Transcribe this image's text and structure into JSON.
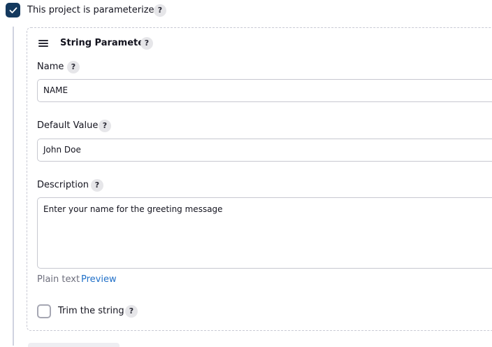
{
  "parameterized": {
    "label": "This project is parameterized",
    "checked": true,
    "help": "?"
  },
  "parameter": {
    "title": "String Parameter",
    "help": "?",
    "name": {
      "label": "Name",
      "help": "?",
      "value": "NAME"
    },
    "default_value": {
      "label": "Default Value",
      "help": "?",
      "value": "John Doe"
    },
    "description": {
      "label": "Description",
      "help": "?",
      "value": "Enter your name for the greeting message",
      "plain_text": "Plain text",
      "preview": "Preview"
    },
    "trim": {
      "label": "Trim the string",
      "help": "?",
      "checked": false
    }
  },
  "colors": {
    "checkbox_checked": "#14395e",
    "link": "#1f6fc8",
    "muted_text": "#6e6f7d"
  }
}
